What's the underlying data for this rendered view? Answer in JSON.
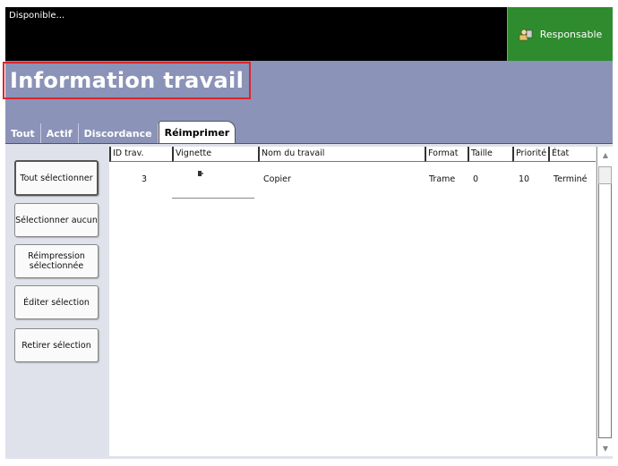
{
  "status": {
    "text": "Disponible..."
  },
  "role_button": {
    "label": "Responsable",
    "icon": "user-role-icon",
    "color": "#2e8b2e"
  },
  "page": {
    "title": "Information travail",
    "title_highlight_color": "#d9262e"
  },
  "tabs": [
    {
      "label": "Tout"
    },
    {
      "label": "Actif"
    },
    {
      "label": "Discordance"
    },
    {
      "label": "Réimprimer",
      "active": true
    }
  ],
  "actions": {
    "select_all": "Tout sélectionner",
    "select_none": "Sélectionner aucun",
    "reprint_selected": "Réimpression sélectionnée",
    "edit_selection": "Éditer sélection",
    "remove_selection": "Retirer sélection"
  },
  "table": {
    "columns": [
      "ID trav.",
      "Vignette",
      "Nom du travail",
      "Format",
      "Taille",
      "Priorité",
      "État"
    ],
    "rows": [
      {
        "id": "3",
        "name": "Copier",
        "format": "Trame",
        "size": "0",
        "priority": "10",
        "state": "Terminé"
      }
    ]
  },
  "colors": {
    "header_bg": "#8b93b8",
    "content_bg": "#dfe2ea",
    "topbar_bg": "#000000"
  }
}
